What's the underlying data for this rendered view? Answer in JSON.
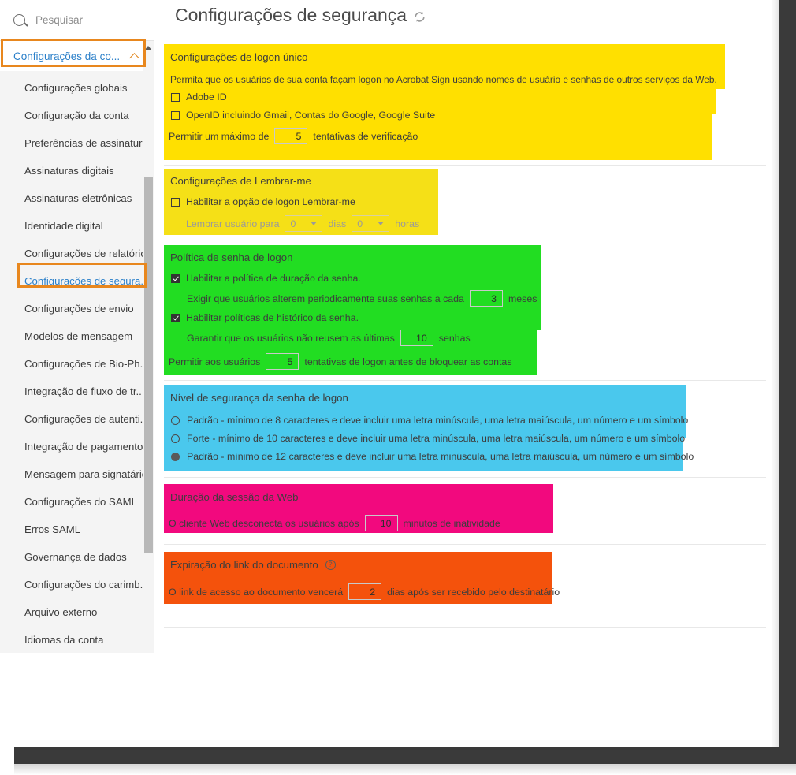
{
  "sidebar": {
    "search": {
      "placeholder": "Pesquisar",
      "value": "",
      "icon": "search-icon"
    },
    "group": {
      "label": "Configurações da co...",
      "icon": "chevron-up-icon"
    },
    "items": [
      {
        "label": "Configurações globais",
        "selected": false
      },
      {
        "label": "Configuração da conta",
        "selected": false
      },
      {
        "label": "Preferências de assinatura",
        "selected": false
      },
      {
        "label": "Assinaturas digitais",
        "selected": false
      },
      {
        "label": "Assinaturas eletrônicas",
        "selected": false
      },
      {
        "label": "Identidade digital",
        "selected": false
      },
      {
        "label": "Configurações de relatório",
        "selected": false
      },
      {
        "label": "Configurações de segura...",
        "selected": true
      },
      {
        "label": "Configurações de envio",
        "selected": false
      },
      {
        "label": "Modelos de mensagem",
        "selected": false
      },
      {
        "label": "Configurações de Bio-Ph...",
        "selected": false
      },
      {
        "label": "Integração de fluxo de tr...",
        "selected": false
      },
      {
        "label": "Configurações de autenti...",
        "selected": false
      },
      {
        "label": "Integração de pagamento",
        "selected": false
      },
      {
        "label": "Mensagem para signatário",
        "selected": false
      },
      {
        "label": "Configurações do SAML",
        "selected": false
      },
      {
        "label": "Erros SAML",
        "selected": false
      },
      {
        "label": "Governança de dados",
        "selected": false
      },
      {
        "label": "Configurações do carimb...",
        "selected": false
      },
      {
        "label": "Arquivo externo",
        "selected": false
      },
      {
        "label": "Idiomas da conta",
        "selected": false
      }
    ]
  },
  "header": {
    "title": "Configurações de segurança",
    "refresh_icon": "refresh-icon"
  },
  "sections": {
    "sso": {
      "title": "Configurações de logon único",
      "description": "Permita que os usuários de sua conta façam logon no Acrobat Sign usando nomes de usuário e senhas de outros serviços da Web.",
      "checkbox_adobe_id": {
        "label": "Adobe ID",
        "checked": false
      },
      "checkbox_openid": {
        "label": "OpenID incluindo Gmail, Contas do Google, Google Suite",
        "checked": false
      },
      "attempts_prefix": "Permitir um máximo de",
      "attempts_value": "5",
      "attempts_suffix": "tentativas de verificação",
      "highlight_color": "#FFE000"
    },
    "remember_me": {
      "title": "Configurações de Lembrar-me",
      "checkbox_enable": {
        "label": "Habilitar a opção de logon Lembrar-me",
        "checked": false
      },
      "remember_prefix": "Lembrar usuário para",
      "days_value": "0",
      "days_label": "dias",
      "hours_value": "0",
      "hours_label": "horas",
      "highlight_color": "#F5E017"
    },
    "password_policy": {
      "title": "Política de senha de logon",
      "checkbox_duration": {
        "label": "Habilitar a política de duração da senha.",
        "checked": true
      },
      "change_prefix": "Exigir que usuários alterem periodicamente suas senhas a cada",
      "change_value": "3",
      "change_suffix": "meses",
      "checkbox_history": {
        "label": "Habilitar políticas de histórico da senha.",
        "checked": true
      },
      "reuse_prefix": "Garantir que os usuários não reusem as últimas",
      "reuse_value": "10",
      "reuse_suffix": "senhas",
      "lock_prefix": "Permitir aos usuários",
      "lock_value": "5",
      "lock_suffix": "tentativas de logon antes de bloquear as contas",
      "highlight_color": "#22DD22"
    },
    "password_strength": {
      "title": "Nível de segurança da senha de logon",
      "options": [
        {
          "label": "Padrão - mínimo de 8 caracteres e deve incluir uma letra minúscula, uma letra maiúscula, um número e um símbolo",
          "selected": false
        },
        {
          "label": "Forte - mínimo de 10 caracteres e deve incluir uma letra minúscula, uma letra maiúscula, um número e um símbolo",
          "selected": false
        },
        {
          "label": "Padrão - mínimo de 12 caracteres e deve incluir uma letra minúscula, uma letra maiúscula, um número e um símbolo",
          "selected": true
        }
      ],
      "highlight_color": "#4AC8ED"
    },
    "web_session": {
      "title": "Duração da sessão da Web",
      "prefix": "O cliente Web desconecta os usuários após",
      "value": "10",
      "suffix": "minutos de inatividade",
      "highlight_color": "#F2097E"
    },
    "link_expiration": {
      "title": "Expiração do link do documento",
      "help_icon": "help-icon",
      "prefix": "O link de acesso ao documento vencerá",
      "value": "2",
      "suffix": "dias após ser recebido pelo destinatário",
      "highlight_color": "#F4520C"
    }
  }
}
